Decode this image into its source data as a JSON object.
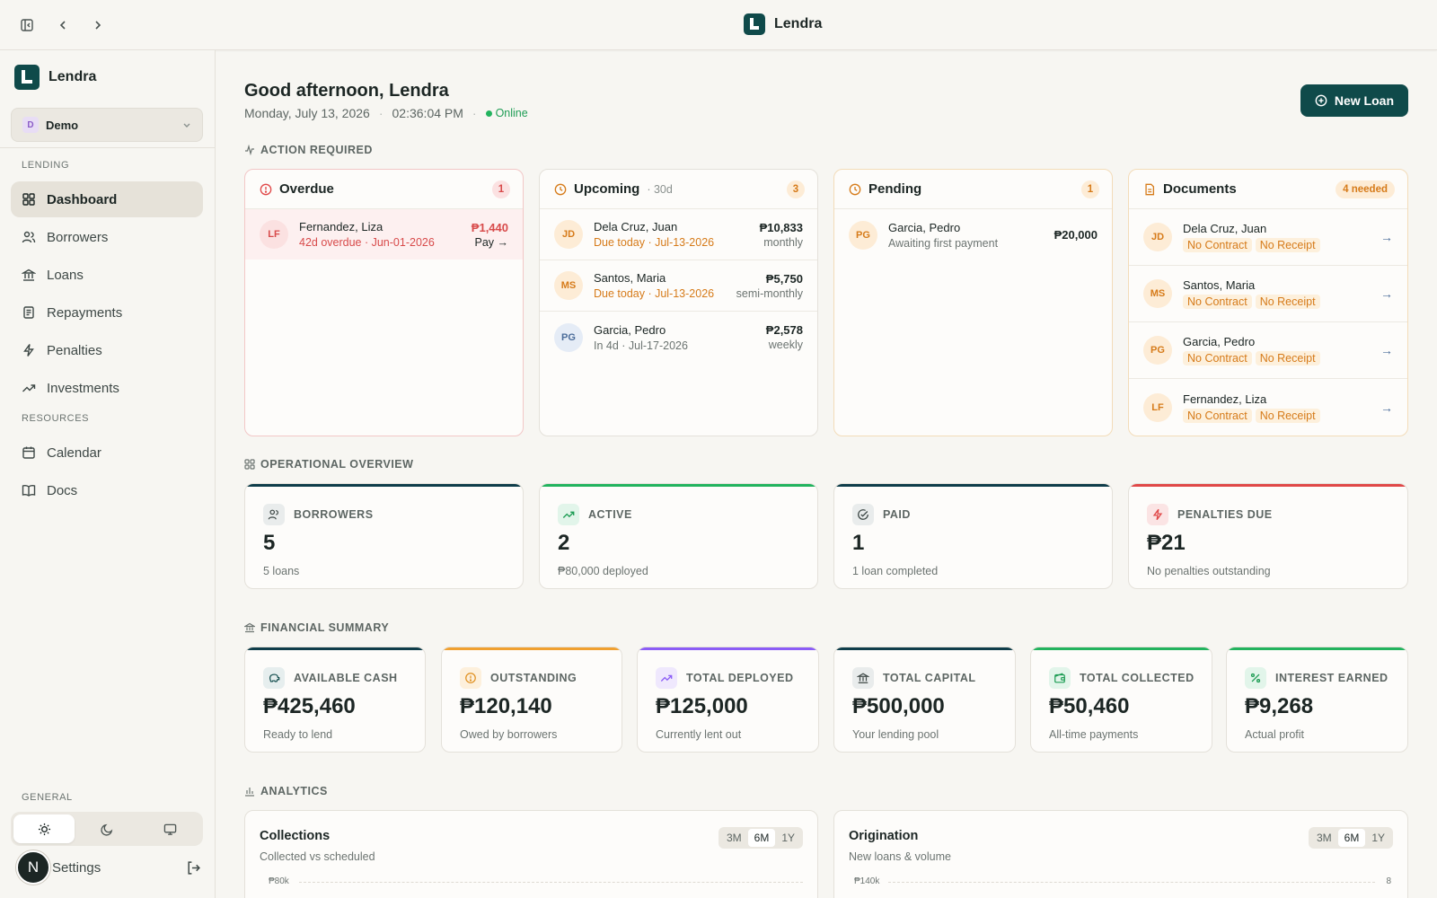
{
  "app": {
    "name": "Lendra"
  },
  "sidebar": {
    "brand": "Lendra",
    "workspace": {
      "initial": "D",
      "name": "Demo"
    },
    "sections": {
      "lending": "LENDING",
      "resources": "RESOURCES",
      "general": "GENERAL"
    },
    "items": [
      {
        "label": "Dashboard",
        "icon": "dashboard-icon"
      },
      {
        "label": "Borrowers",
        "icon": "users-icon"
      },
      {
        "label": "Loans",
        "icon": "bank-icon"
      },
      {
        "label": "Repayments",
        "icon": "receipt-icon"
      },
      {
        "label": "Penalties",
        "icon": "bolt-icon"
      },
      {
        "label": "Investments",
        "icon": "trend-icon"
      },
      {
        "label": "Calendar",
        "icon": "calendar-icon"
      },
      {
        "label": "Docs",
        "icon": "book-icon"
      }
    ],
    "settings_label": "Settings",
    "avatar_initial": "N"
  },
  "header": {
    "greeting": "Good afternoon, Lendra",
    "date": "Monday, July 13, 2026",
    "time": "02:36:04 PM",
    "status": "Online",
    "new_loan_label": "New Loan"
  },
  "action_required": {
    "title": "ACTION REQUIRED",
    "overdue": {
      "title": "Overdue",
      "count": "1",
      "rows": [
        {
          "initials": "LF",
          "name": "Fernandez, Liza",
          "meta": "42d overdue · Jun-01-2026",
          "amount": "₱1,440",
          "action": "Pay →"
        }
      ]
    },
    "upcoming": {
      "title": "Upcoming",
      "sub": "· 30d",
      "count": "3",
      "rows": [
        {
          "initials": "JD",
          "name": "Dela Cruz, Juan",
          "meta": "Due today · Jul-13-2026",
          "amount": "₱10,833",
          "freq": "monthly"
        },
        {
          "initials": "MS",
          "name": "Santos, Maria",
          "meta": "Due today · Jul-13-2026",
          "amount": "₱5,750",
          "freq": "semi-monthly"
        },
        {
          "initials": "PG",
          "name": "Garcia, Pedro",
          "meta": "In 4d · Jul-17-2026",
          "amount": "₱2,578",
          "freq": "weekly"
        }
      ]
    },
    "pending": {
      "title": "Pending",
      "count": "1",
      "rows": [
        {
          "initials": "PG",
          "name": "Garcia, Pedro",
          "meta": "Awaiting first payment",
          "amount": "₱20,000"
        }
      ]
    },
    "documents": {
      "title": "Documents",
      "count": "4 needed",
      "tag1": "No Contract",
      "tag2": "No Receipt",
      "rows": [
        {
          "initials": "JD",
          "name": "Dela Cruz, Juan"
        },
        {
          "initials": "MS",
          "name": "Santos, Maria"
        },
        {
          "initials": "PG",
          "name": "Garcia, Pedro"
        },
        {
          "initials": "LF",
          "name": "Fernandez, Liza"
        }
      ]
    }
  },
  "operational": {
    "title": "OPERATIONAL OVERVIEW",
    "cards": [
      {
        "label": "BORROWERS",
        "value": "5",
        "caption": "5 loans",
        "accent": "#0f3d4a"
      },
      {
        "label": "ACTIVE",
        "value": "2",
        "caption": "₱80,000 deployed",
        "accent": "#22b35e"
      },
      {
        "label": "PAID",
        "value": "1",
        "caption": "1 loan completed",
        "accent": "#0f3d4a"
      },
      {
        "label": "PENALTIES DUE",
        "value": "₱21",
        "caption": "No penalties outstanding",
        "accent": "#e04848"
      }
    ]
  },
  "financial": {
    "title": "FINANCIAL SUMMARY",
    "cards": [
      {
        "label": "AVAILABLE CASH",
        "value": "₱425,460",
        "caption": "Ready to lend",
        "accent": "#0f3d4a"
      },
      {
        "label": "OUTSTANDING",
        "value": "₱120,140",
        "caption": "Owed by borrowers",
        "accent": "#f0a030"
      },
      {
        "label": "TOTAL DEPLOYED",
        "value": "₱125,000",
        "caption": "Currently lent out",
        "accent": "#8b5cf6"
      },
      {
        "label": "TOTAL CAPITAL",
        "value": "₱500,000",
        "caption": "Your lending pool",
        "accent": "#0f3d4a"
      },
      {
        "label": "TOTAL COLLECTED",
        "value": "₱50,460",
        "caption": "All-time payments",
        "accent": "#22b35e"
      },
      {
        "label": "INTEREST EARNED",
        "value": "₱9,268",
        "caption": "Actual profit",
        "accent": "#22b35e"
      }
    ]
  },
  "analytics": {
    "title": "ANALYTICS",
    "collections": {
      "title": "Collections",
      "sub": "Collected vs scheduled",
      "ytick": "₱80k"
    },
    "origination": {
      "title": "Origination",
      "sub": "New loans & volume",
      "ytick": "₱140k",
      "ytick_right": "8"
    },
    "ranges": [
      "3M",
      "6M",
      "1Y"
    ],
    "selected_range": "6M"
  }
}
